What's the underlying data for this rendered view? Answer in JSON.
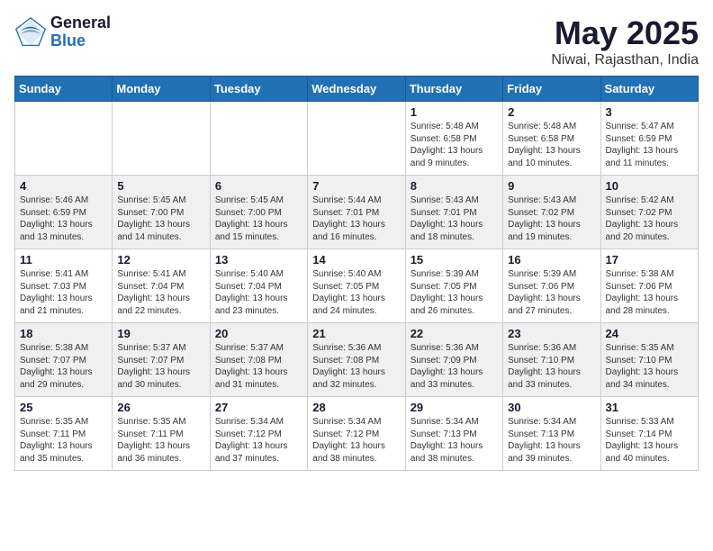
{
  "header": {
    "logo_general": "General",
    "logo_blue": "Blue",
    "month": "May 2025",
    "location": "Niwai, Rajasthan, India"
  },
  "weekdays": [
    "Sunday",
    "Monday",
    "Tuesday",
    "Wednesday",
    "Thursday",
    "Friday",
    "Saturday"
  ],
  "weeks": [
    [
      {
        "day": "",
        "info": ""
      },
      {
        "day": "",
        "info": ""
      },
      {
        "day": "",
        "info": ""
      },
      {
        "day": "",
        "info": ""
      },
      {
        "day": "1",
        "info": "Sunrise: 5:48 AM\nSunset: 6:58 PM\nDaylight: 13 hours\nand 9 minutes."
      },
      {
        "day": "2",
        "info": "Sunrise: 5:48 AM\nSunset: 6:58 PM\nDaylight: 13 hours\nand 10 minutes."
      },
      {
        "day": "3",
        "info": "Sunrise: 5:47 AM\nSunset: 6:59 PM\nDaylight: 13 hours\nand 11 minutes."
      }
    ],
    [
      {
        "day": "4",
        "info": "Sunrise: 5:46 AM\nSunset: 6:59 PM\nDaylight: 13 hours\nand 13 minutes."
      },
      {
        "day": "5",
        "info": "Sunrise: 5:45 AM\nSunset: 7:00 PM\nDaylight: 13 hours\nand 14 minutes."
      },
      {
        "day": "6",
        "info": "Sunrise: 5:45 AM\nSunset: 7:00 PM\nDaylight: 13 hours\nand 15 minutes."
      },
      {
        "day": "7",
        "info": "Sunrise: 5:44 AM\nSunset: 7:01 PM\nDaylight: 13 hours\nand 16 minutes."
      },
      {
        "day": "8",
        "info": "Sunrise: 5:43 AM\nSunset: 7:01 PM\nDaylight: 13 hours\nand 18 minutes."
      },
      {
        "day": "9",
        "info": "Sunrise: 5:43 AM\nSunset: 7:02 PM\nDaylight: 13 hours\nand 19 minutes."
      },
      {
        "day": "10",
        "info": "Sunrise: 5:42 AM\nSunset: 7:02 PM\nDaylight: 13 hours\nand 20 minutes."
      }
    ],
    [
      {
        "day": "11",
        "info": "Sunrise: 5:41 AM\nSunset: 7:03 PM\nDaylight: 13 hours\nand 21 minutes."
      },
      {
        "day": "12",
        "info": "Sunrise: 5:41 AM\nSunset: 7:04 PM\nDaylight: 13 hours\nand 22 minutes."
      },
      {
        "day": "13",
        "info": "Sunrise: 5:40 AM\nSunset: 7:04 PM\nDaylight: 13 hours\nand 23 minutes."
      },
      {
        "day": "14",
        "info": "Sunrise: 5:40 AM\nSunset: 7:05 PM\nDaylight: 13 hours\nand 24 minutes."
      },
      {
        "day": "15",
        "info": "Sunrise: 5:39 AM\nSunset: 7:05 PM\nDaylight: 13 hours\nand 26 minutes."
      },
      {
        "day": "16",
        "info": "Sunrise: 5:39 AM\nSunset: 7:06 PM\nDaylight: 13 hours\nand 27 minutes."
      },
      {
        "day": "17",
        "info": "Sunrise: 5:38 AM\nSunset: 7:06 PM\nDaylight: 13 hours\nand 28 minutes."
      }
    ],
    [
      {
        "day": "18",
        "info": "Sunrise: 5:38 AM\nSunset: 7:07 PM\nDaylight: 13 hours\nand 29 minutes."
      },
      {
        "day": "19",
        "info": "Sunrise: 5:37 AM\nSunset: 7:07 PM\nDaylight: 13 hours\nand 30 minutes."
      },
      {
        "day": "20",
        "info": "Sunrise: 5:37 AM\nSunset: 7:08 PM\nDaylight: 13 hours\nand 31 minutes."
      },
      {
        "day": "21",
        "info": "Sunrise: 5:36 AM\nSunset: 7:08 PM\nDaylight: 13 hours\nand 32 minutes."
      },
      {
        "day": "22",
        "info": "Sunrise: 5:36 AM\nSunset: 7:09 PM\nDaylight: 13 hours\nand 33 minutes."
      },
      {
        "day": "23",
        "info": "Sunrise: 5:36 AM\nSunset: 7:10 PM\nDaylight: 13 hours\nand 33 minutes."
      },
      {
        "day": "24",
        "info": "Sunrise: 5:35 AM\nSunset: 7:10 PM\nDaylight: 13 hours\nand 34 minutes."
      }
    ],
    [
      {
        "day": "25",
        "info": "Sunrise: 5:35 AM\nSunset: 7:11 PM\nDaylight: 13 hours\nand 35 minutes."
      },
      {
        "day": "26",
        "info": "Sunrise: 5:35 AM\nSunset: 7:11 PM\nDaylight: 13 hours\nand 36 minutes."
      },
      {
        "day": "27",
        "info": "Sunrise: 5:34 AM\nSunset: 7:12 PM\nDaylight: 13 hours\nand 37 minutes."
      },
      {
        "day": "28",
        "info": "Sunrise: 5:34 AM\nSunset: 7:12 PM\nDaylight: 13 hours\nand 38 minutes."
      },
      {
        "day": "29",
        "info": "Sunrise: 5:34 AM\nSunset: 7:13 PM\nDaylight: 13 hours\nand 38 minutes."
      },
      {
        "day": "30",
        "info": "Sunrise: 5:34 AM\nSunset: 7:13 PM\nDaylight: 13 hours\nand 39 minutes."
      },
      {
        "day": "31",
        "info": "Sunrise: 5:33 AM\nSunset: 7:14 PM\nDaylight: 13 hours\nand 40 minutes."
      }
    ]
  ]
}
